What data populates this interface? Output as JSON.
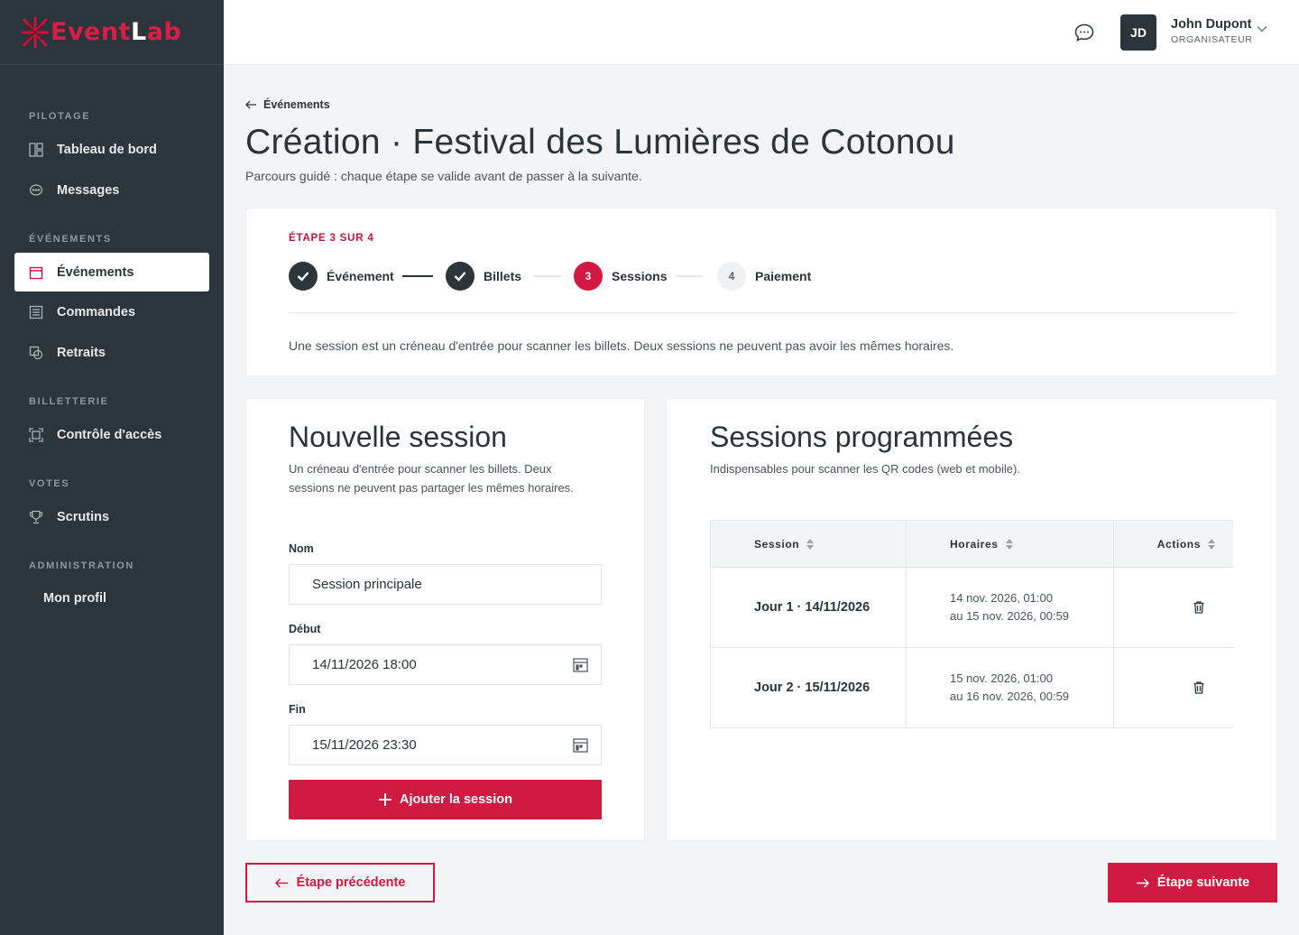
{
  "brand": {
    "part1": "Event",
    "part2": "L",
    "part3": "ab"
  },
  "topbar": {
    "user_initials": "JD",
    "user_name": "John Dupont",
    "user_role": "ORGANISATEUR"
  },
  "sidebar": {
    "sections": [
      {
        "title": "PILOTAGE"
      },
      {
        "title": "ÉVÉNEMENTS"
      },
      {
        "title": "BILLETTERIE"
      },
      {
        "title": "VOTES"
      },
      {
        "title": "ADMINISTRATION"
      }
    ],
    "items": [
      {
        "label": "Tableau de bord",
        "icon": "dashboard-icon"
      },
      {
        "label": "Messages",
        "icon": "chat-icon"
      },
      {
        "label": "Événements",
        "icon": "calendar-icon",
        "active": true
      },
      {
        "label": "Commandes",
        "icon": "orders-icon"
      },
      {
        "label": "Retraits",
        "icon": "withdraw-icon"
      },
      {
        "label": "Contrôle d'accès",
        "icon": "scan-icon"
      },
      {
        "label": "Scrutins",
        "icon": "trophy-icon"
      },
      {
        "label": "Mon profil",
        "icon": ""
      }
    ]
  },
  "header": {
    "back_label": "Événements",
    "title": "Création · Festival des Lumières de Cotonou",
    "subtitle": "Parcours guidé : chaque étape se valide avant de passer à la suivante."
  },
  "stepper": {
    "label": "ÉTAPE 3 SUR 4",
    "steps": [
      {
        "number": "",
        "label": "Événement",
        "status": "done"
      },
      {
        "number": "",
        "label": "Billets",
        "status": "done"
      },
      {
        "number": "3",
        "label": "Sessions",
        "status": "current"
      },
      {
        "number": "4",
        "label": "Paiement",
        "status": "todo"
      }
    ],
    "info": "Une session est un créneau d'entrée pour scanner les billets. Deux sessions ne peuvent pas avoir les mêmes horaires."
  },
  "form": {
    "title": "Nouvelle session",
    "description": "Un créneau d'entrée pour scanner les billets. Deux sessions ne peuvent pas partager les mêmes horaires.",
    "name_label": "Nom",
    "name_value": "Session principale",
    "start_label": "Début",
    "start_value": "14/11/2026 18:00",
    "end_label": "Fin",
    "end_value": "15/11/2026 23:30",
    "submit_label": "Ajouter la session"
  },
  "sessions": {
    "title": "Sessions programmées",
    "description": "Indispensables pour scanner les QR codes (web et mobile).",
    "columns": [
      "Session",
      "Horaires",
      "Actions"
    ],
    "rows": [
      {
        "name": "Jour 1 · 14/11/2026",
        "from": "14 nov. 2026, 01:00",
        "to": "au 15 nov. 2026, 00:59"
      },
      {
        "name": "Jour 2 · 15/11/2026",
        "from": "15 nov. 2026, 01:00",
        "to": "au 16 nov. 2026, 00:59"
      }
    ]
  },
  "footer": {
    "prev_label": "Étape précédente",
    "next_label": "Étape suivante"
  },
  "colors": {
    "accent": "#cf1a42",
    "sidebar": "#2b353b"
  }
}
